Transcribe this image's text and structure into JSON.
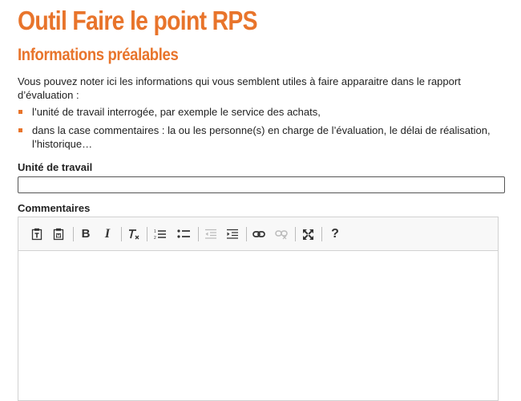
{
  "page": {
    "title": "Outil Faire le point RPS",
    "section_title": "Informations préalables",
    "intro": "Vous pouvez noter ici les informations qui vous semblent utiles à faire apparaitre dans le rapport d’évaluation :",
    "bullets": [
      "l’unité de travail interrogée, par exemple le service des achats,",
      "dans la case commentaires : la ou les personne(s) en charge de l’évaluation, le délai de réalisation, l’historique…"
    ]
  },
  "form": {
    "unit_label": "Unité de travail",
    "unit_value": "",
    "comments_label": "Commentaires",
    "comments_value": ""
  },
  "toolbar": {
    "bold_label": "B",
    "italic_label": "I",
    "help_label": "?",
    "icons": [
      "paste-text-icon",
      "paste-from-word-icon",
      "bold-icon",
      "italic-icon",
      "remove-format-icon",
      "numbered-list-icon",
      "bulleted-list-icon",
      "decrease-indent-icon",
      "increase-indent-icon",
      "link-icon",
      "unlink-icon",
      "maximize-icon",
      "help-icon"
    ]
  },
  "colors": {
    "accent": "#e8742b",
    "text": "#222222",
    "toolbar_bg": "#f8f8f8",
    "border": "#d1d1d1"
  }
}
